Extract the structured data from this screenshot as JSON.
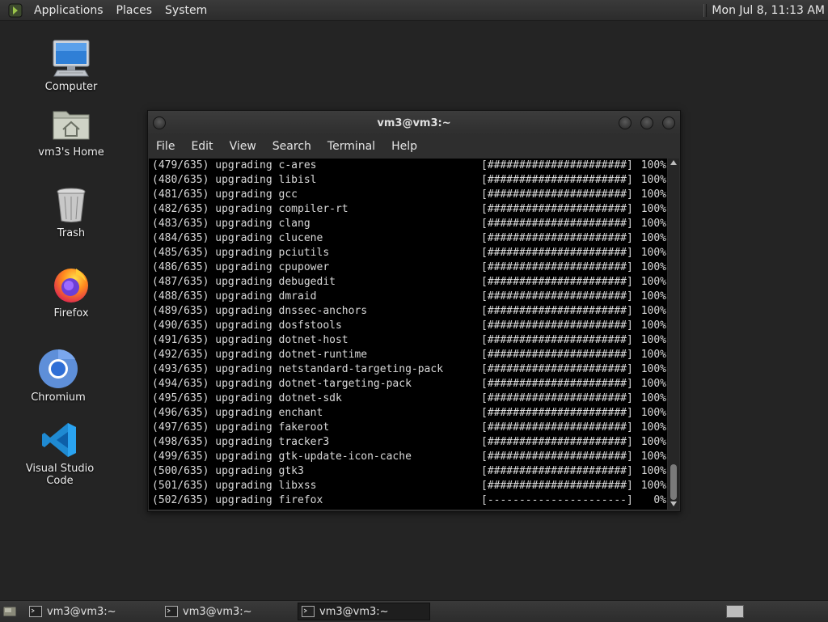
{
  "top_panel": {
    "menus": [
      "Applications",
      "Places",
      "System"
    ],
    "clock": "Mon Jul  8, 11:13 AM"
  },
  "desktop": {
    "icons": [
      {
        "label": "Computer",
        "icon": "computer-icon"
      },
      {
        "label": "vm3's Home",
        "icon": "home-folder-icon"
      },
      {
        "label": "Trash",
        "icon": "trash-icon"
      },
      {
        "label": "Firefox",
        "icon": "firefox-icon"
      },
      {
        "label": "Chromium",
        "icon": "chromium-icon"
      },
      {
        "label": "Visual Studio Code",
        "icon": "vscode-icon"
      }
    ]
  },
  "window": {
    "title": "vm3@vm3:~",
    "menus": [
      "File",
      "Edit",
      "View",
      "Search",
      "Terminal",
      "Help"
    ],
    "lines": [
      {
        "pkg": "(479/635) upgrading c-ares",
        "bar": "[######################]",
        "pct": "100%"
      },
      {
        "pkg": "(480/635) upgrading libisl",
        "bar": "[######################]",
        "pct": "100%"
      },
      {
        "pkg": "(481/635) upgrading gcc",
        "bar": "[######################]",
        "pct": "100%"
      },
      {
        "pkg": "(482/635) upgrading compiler-rt",
        "bar": "[######################]",
        "pct": "100%"
      },
      {
        "pkg": "(483/635) upgrading clang",
        "bar": "[######################]",
        "pct": "100%"
      },
      {
        "pkg": "(484/635) upgrading clucene",
        "bar": "[######################]",
        "pct": "100%"
      },
      {
        "pkg": "(485/635) upgrading pciutils",
        "bar": "[######################]",
        "pct": "100%"
      },
      {
        "pkg": "(486/635) upgrading cpupower",
        "bar": "[######################]",
        "pct": "100%"
      },
      {
        "pkg": "(487/635) upgrading debugedit",
        "bar": "[######################]",
        "pct": "100%"
      },
      {
        "pkg": "(488/635) upgrading dmraid",
        "bar": "[######################]",
        "pct": "100%"
      },
      {
        "pkg": "(489/635) upgrading dnssec-anchors",
        "bar": "[######################]",
        "pct": "100%"
      },
      {
        "pkg": "(490/635) upgrading dosfstools",
        "bar": "[######################]",
        "pct": "100%"
      },
      {
        "pkg": "(491/635) upgrading dotnet-host",
        "bar": "[######################]",
        "pct": "100%"
      },
      {
        "pkg": "(492/635) upgrading dotnet-runtime",
        "bar": "[######################]",
        "pct": "100%"
      },
      {
        "pkg": "(493/635) upgrading netstandard-targeting-pack",
        "bar": "[######################]",
        "pct": "100%"
      },
      {
        "pkg": "(494/635) upgrading dotnet-targeting-pack",
        "bar": "[######################]",
        "pct": "100%"
      },
      {
        "pkg": "(495/635) upgrading dotnet-sdk",
        "bar": "[######################]",
        "pct": "100%"
      },
      {
        "pkg": "(496/635) upgrading enchant",
        "bar": "[######################]",
        "pct": "100%"
      },
      {
        "pkg": "(497/635) upgrading fakeroot",
        "bar": "[######################]",
        "pct": "100%"
      },
      {
        "pkg": "(498/635) upgrading tracker3",
        "bar": "[######################]",
        "pct": "100%"
      },
      {
        "pkg": "(499/635) upgrading gtk-update-icon-cache",
        "bar": "[######################]",
        "pct": "100%"
      },
      {
        "pkg": "(500/635) upgrading gtk3",
        "bar": "[######################]",
        "pct": "100%"
      },
      {
        "pkg": "(501/635) upgrading libxss",
        "bar": "[######################]",
        "pct": "100%"
      },
      {
        "pkg": "(502/635) upgrading firefox",
        "bar": "[----------------------]",
        "pct": "0%"
      }
    ]
  },
  "taskbar": {
    "tasks": [
      {
        "label": "vm3@vm3:~",
        "active": false
      },
      {
        "label": "vm3@vm3:~",
        "active": false
      },
      {
        "label": "vm3@vm3:~",
        "active": true
      }
    ]
  }
}
